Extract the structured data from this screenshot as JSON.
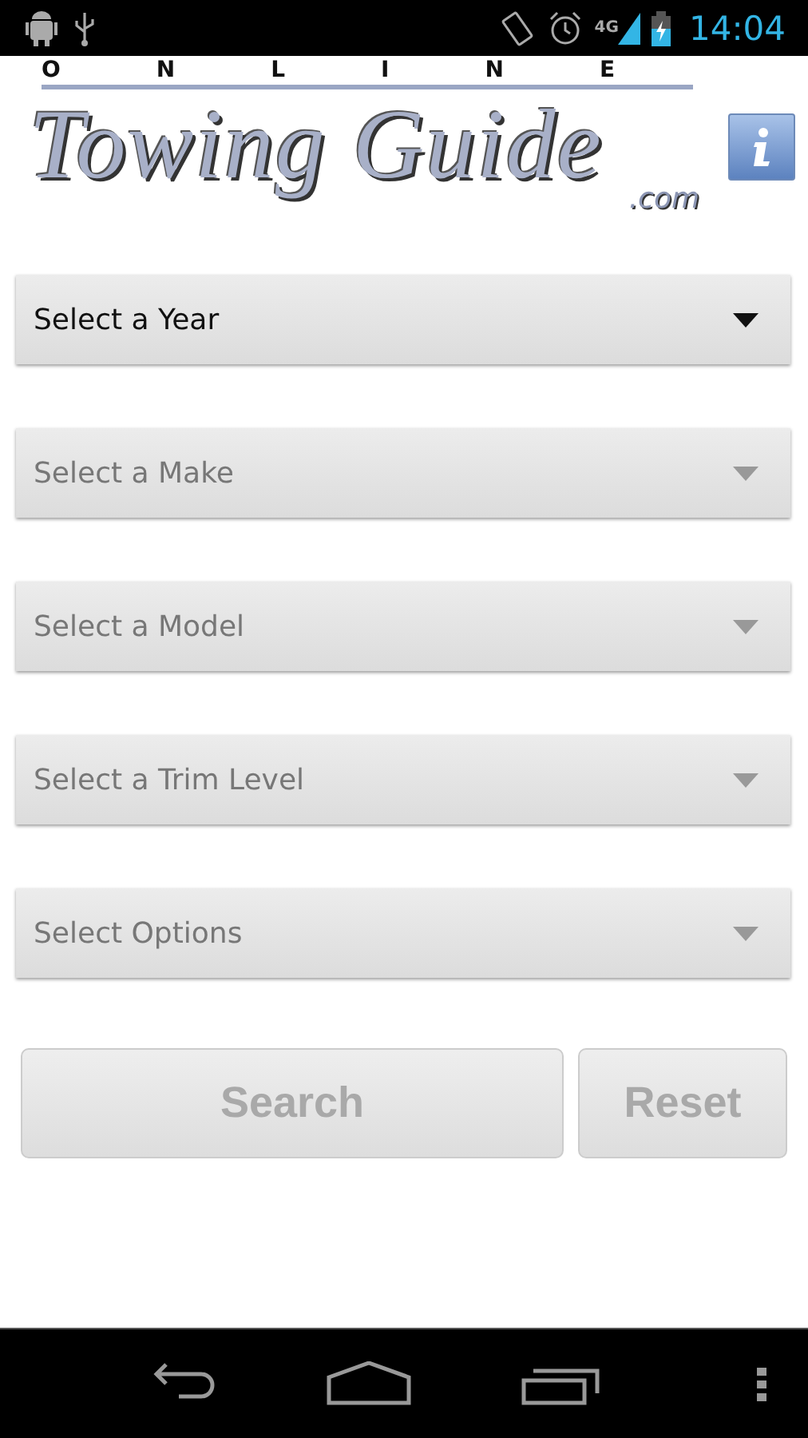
{
  "status_bar": {
    "network": "4G",
    "time": "14:04"
  },
  "logo": {
    "top": "ONLINE",
    "name": "Towing Guide",
    "suffix": ".com"
  },
  "dropdowns": [
    {
      "label": "Select a Year",
      "disabled": false
    },
    {
      "label": "Select a Make",
      "disabled": true
    },
    {
      "label": "Select a Model",
      "disabled": true
    },
    {
      "label": "Select a Trim Level",
      "disabled": true
    },
    {
      "label": "Select Options",
      "disabled": true
    }
  ],
  "buttons": [
    {
      "label": "Search",
      "kind": "search",
      "disabled": true
    },
    {
      "label": "Reset",
      "kind": "reset",
      "disabled": true
    }
  ]
}
